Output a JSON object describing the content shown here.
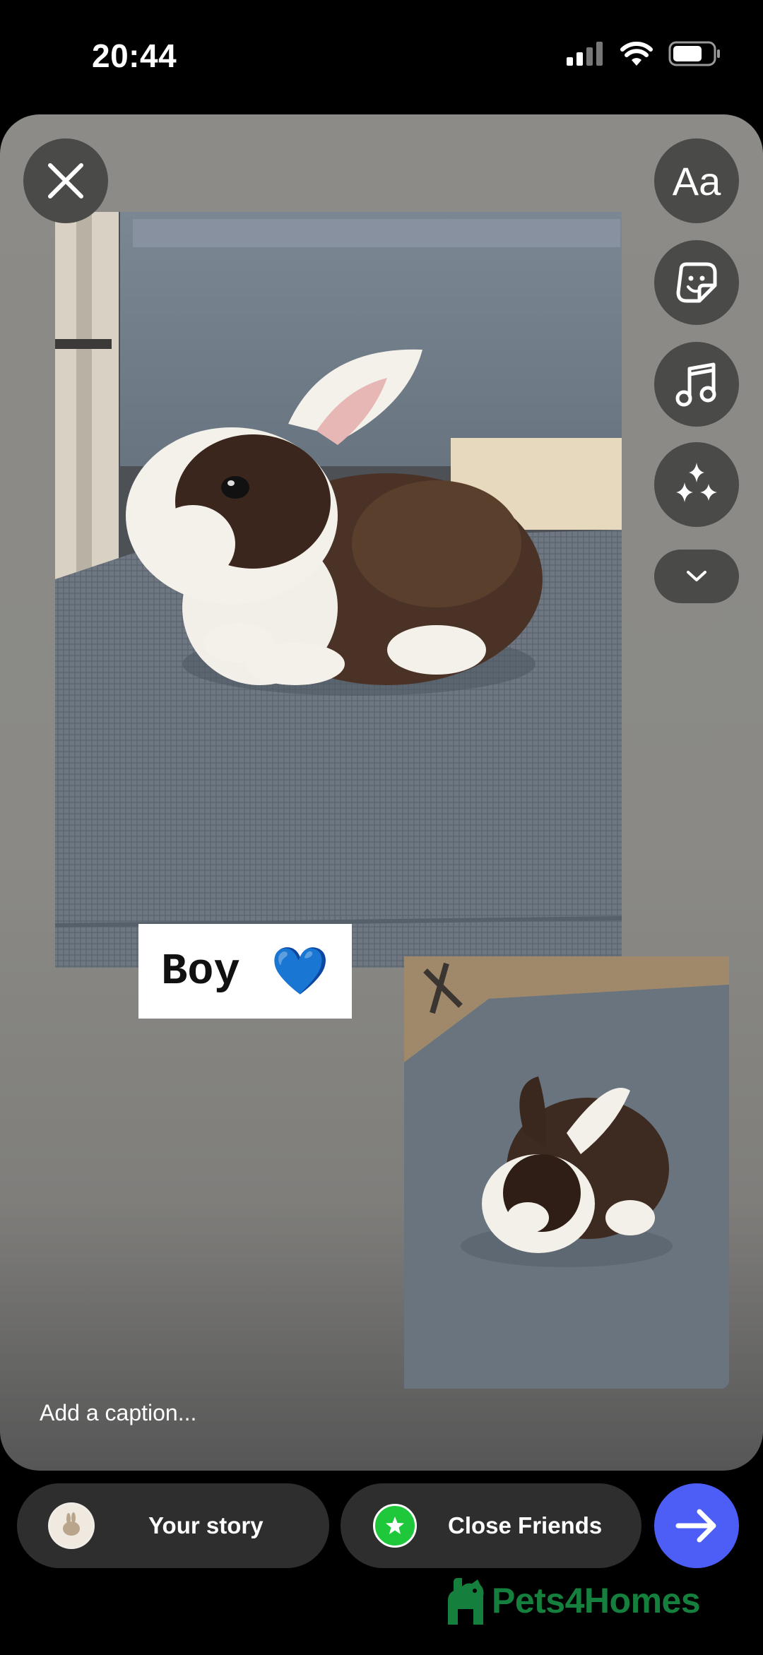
{
  "status_bar": {
    "time": "20:44",
    "icons": [
      "cellular-signal-icon",
      "wifi-icon",
      "battery-icon"
    ]
  },
  "editor": {
    "close_icon": "close-icon",
    "tools": [
      {
        "name": "text-tool",
        "label": "Aa"
      },
      {
        "name": "sticker-tool",
        "icon": "sticker-icon"
      },
      {
        "name": "music-tool",
        "icon": "music-note-icon"
      },
      {
        "name": "effects-tool",
        "icon": "sparkles-icon"
      },
      {
        "name": "more-tools",
        "icon": "chevron-down-icon"
      }
    ],
    "photos": [
      {
        "name": "rabbit-photo-main",
        "subject": "brown and white baby rabbit sitting on grey mesh chair"
      },
      {
        "name": "rabbit-photo-secondary",
        "subject": "brown and white baby rabbit seen from above on grey mesh"
      }
    ],
    "text_sticker": {
      "text": "Boy",
      "emoji": "💙"
    },
    "caption_placeholder": "Add a caption..."
  },
  "share_bar": {
    "your_story_label": "Your story",
    "close_friends_label": "Close Friends",
    "send_icon": "arrow-right-icon"
  },
  "watermark": {
    "text": "Pets4Homes"
  },
  "colors": {
    "send_button": "#4c5ef5",
    "close_friends_green": "#1fc83b",
    "watermark_green": "#15803d"
  }
}
